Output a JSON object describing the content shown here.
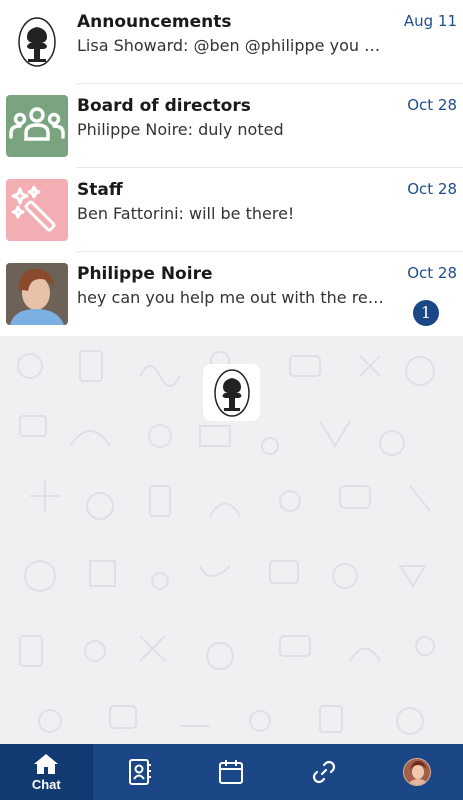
{
  "chats": [
    {
      "title": "Announcements",
      "preview": "Lisa Showard: @ben @philippe you are …",
      "date": "Aug 11",
      "avatar": "ncfdn-logo"
    },
    {
      "title": "Board of directors",
      "preview": "Philippe Noire: duly noted",
      "date": "Oct 28",
      "avatar": "group-icon"
    },
    {
      "title": "Staff",
      "preview": "Ben Fattorini: will be there!",
      "date": "Oct 28",
      "avatar": "magic-wand-icon"
    },
    {
      "title": "Philippe Noire",
      "preview": "hey can you help me out with the repo…",
      "date": "Oct 28",
      "avatar": "person-photo",
      "unread": "1"
    }
  ],
  "tabs": [
    {
      "name": "chat",
      "label": "Chat",
      "icon": "home-icon",
      "active": true
    },
    {
      "name": "contacts",
      "icon": "contacts-book-icon"
    },
    {
      "name": "calendar",
      "icon": "calendar-icon"
    },
    {
      "name": "links",
      "icon": "link-icon"
    },
    {
      "name": "profile",
      "icon": "profile-avatar"
    }
  ],
  "colors": {
    "accent": "#1b4787",
    "date": "#1f4e8c",
    "board": "#7aa47f",
    "staff": "#f2aeb2"
  }
}
